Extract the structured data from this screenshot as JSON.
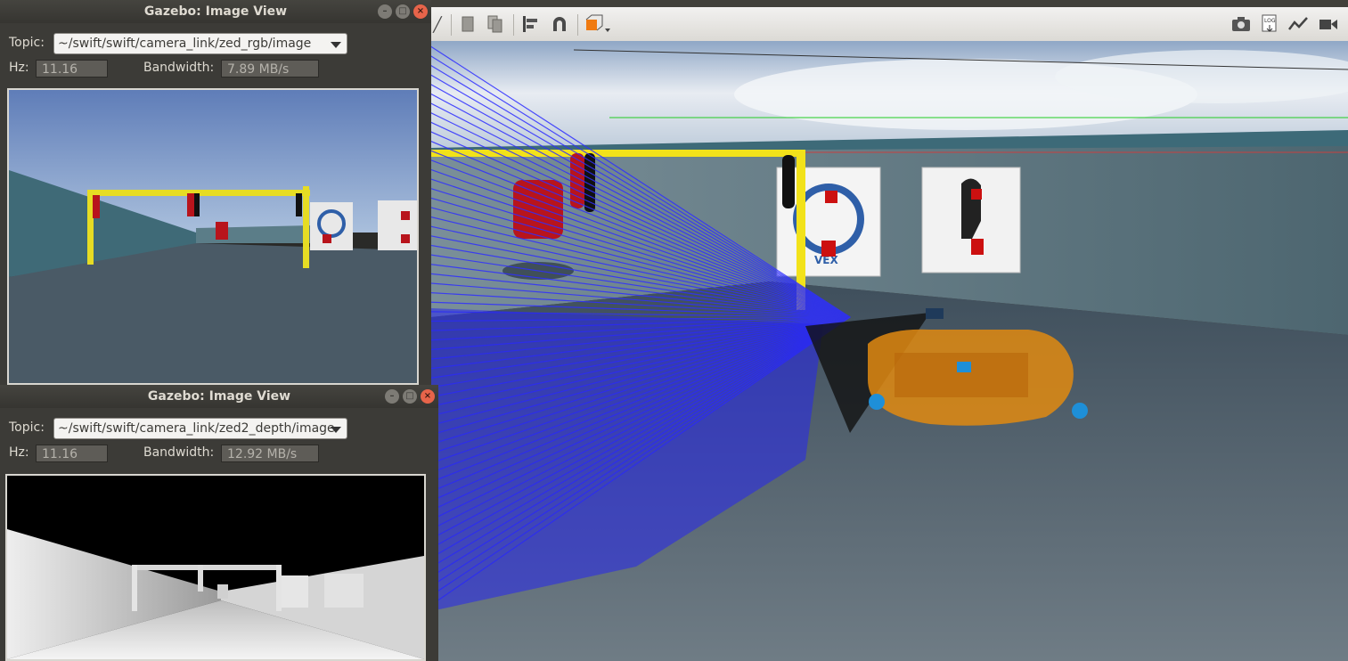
{
  "windows": [
    {
      "title": "Gazebo: Image View",
      "topic_label": "Topic:",
      "topic_value": "~/swift/swift/camera_link/zed_rgb/image",
      "hz_label": "Hz:",
      "hz_value": "11.16",
      "bandwidth_label": "Bandwidth:",
      "bandwidth_value": "7.89 MB/s"
    },
    {
      "title": "Gazebo: Image View",
      "topic_label": "Topic:",
      "topic_value": "~/swift/swift/camera_link/zed2_depth/image",
      "hz_label": "Hz:",
      "hz_value": "11.16",
      "bandwidth_label": "Bandwidth:",
      "bandwidth_value": "12.92 MB/s"
    }
  ],
  "toolbar": {
    "left_icons": [
      "select-arrow-icon",
      "copy-icon",
      "paste-icon",
      "align-icon",
      "magnet-icon",
      "view-angle-icon"
    ],
    "right_icons": [
      "screenshot-camera-icon",
      "log-icon",
      "plot-icon",
      "video-record-icon"
    ],
    "log_text": "LOG"
  },
  "scene": {
    "sign_text": "VEX",
    "colors": {
      "laser": "#2f2fff",
      "gate": "#f2e21a",
      "robot": "#e08a10",
      "buoy": "#cc1010"
    }
  }
}
